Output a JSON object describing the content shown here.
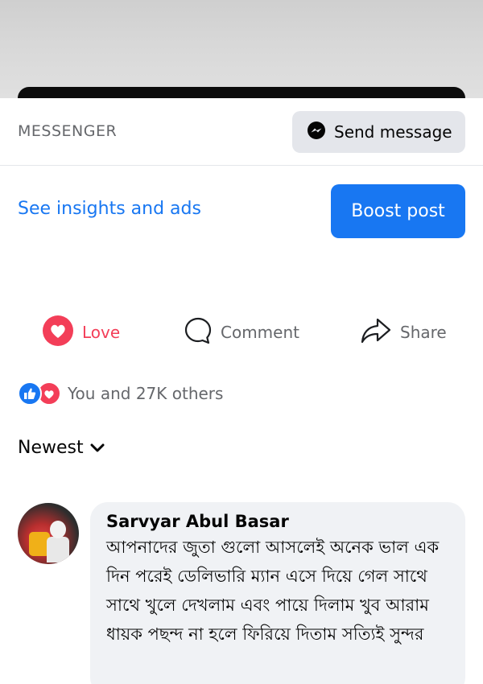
{
  "messenger_bar": {
    "label": "MESSENGER",
    "send_button": {
      "label": "Send message",
      "icon": "messenger-icon"
    }
  },
  "insights": {
    "link": "See insights and ads",
    "boost_button": "Boost post"
  },
  "actions": {
    "love": {
      "label": "Love",
      "icon": "heart-icon",
      "color": "#f33e58"
    },
    "comment": {
      "label": "Comment",
      "icon": "comment-bubble-icon"
    },
    "share": {
      "label": "Share",
      "icon": "share-arrow-icon"
    }
  },
  "reactions": {
    "icons": [
      "like-icon",
      "heart-icon"
    ],
    "summary": "You and 27K others"
  },
  "comments_sort": {
    "label": "Newest",
    "icon": "chevron-down-icon"
  },
  "comments": [
    {
      "author": "Sarvyar Abul Basar",
      "text": "আপনাদের জুতা গুলো আসলেই অনেক ভাল এক দিন পরেই ডেলিভারি ম্যান এসে দিয়ে গেল সাথে সাথে খুলে দেখলাম এবং পায়ে দিলাম খুব আরাম ধায়ক পছন্দ না হলে ফিরিয়ে দিতাম সত্যিই সুন্দর"
    }
  ],
  "colors": {
    "accent": "#1877f2",
    "love": "#f33e58",
    "muted": "#65676b",
    "bubble": "#f0f2f5"
  }
}
